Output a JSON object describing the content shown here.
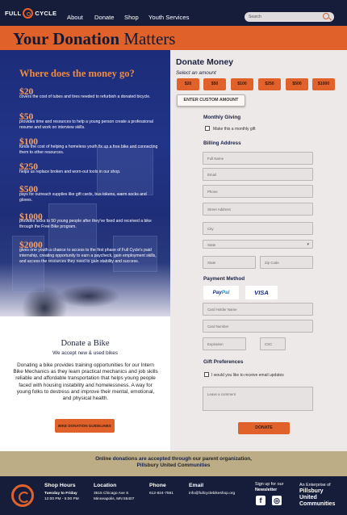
{
  "header": {
    "logo_text_left": "FULL",
    "logo_text_right": "CYCLE",
    "nav": [
      "About",
      "Donate",
      "Shop",
      "Youth Services"
    ],
    "search_placeholder": "Search"
  },
  "page_title": {
    "bold": "Your Donation",
    "normal": "Matters"
  },
  "money": {
    "heading": "Where does the money go?",
    "items": [
      {
        "amount": "$20",
        "text": "covers the cost of tubes and tires needed to refurbish a donated bicycle."
      },
      {
        "amount": "$50",
        "text": "provides time and resources to help a young person create a professional resume and work on interview skills."
      },
      {
        "amount": "$100",
        "text": "funds the cost of helping a homeless youth fix up a free bike and connecting them to other resources."
      },
      {
        "amount": "$250",
        "text": "helps us replace broken and worn-out tools in our shop."
      },
      {
        "amount": "$500",
        "text": "pays for outreach supplies like gift cards, bus tokens, warm socks and gloves."
      },
      {
        "amount": "$1000",
        "text": "provides locks to 50 young people after they've fixed and received a bike through the Free Bike program."
      },
      {
        "amount": "$2000",
        "text": "gives one youth a chance to access to the first phase of Full Cycle's paid internship, creating opportunity to earn a paycheck, gain employment skills, and access the resources they need to gain stability and success."
      }
    ]
  },
  "bike": {
    "title": "Donate a Bike",
    "subtitle": "We accept new & used bikes",
    "body": "Donating a bike provides training opportunities for our Intern Bike Mechanics as they learn practical mechanics and job skills reliable and affordable transportation that helps young people faced with housing instability and homelessness. A way for young folks to destress and improve their mental, emotional, and physical health.",
    "button": "BIKE DONATION GUIDELINES"
  },
  "form": {
    "title": "Donate Money",
    "subtitle": "Select an amount",
    "amounts": [
      "$20",
      "$50",
      "$100",
      "$250",
      "$500",
      "$1000"
    ],
    "custom_button": "ENTER CUSTOM AMOUNT",
    "monthly_heading": "Monthly Giving",
    "monthly_label": "Make this a monthly gift",
    "billing_heading": "Billing Address",
    "fields": {
      "full_name": "Full Name",
      "email": "Email",
      "phone": "Phone",
      "street": "Street Address",
      "city": "City",
      "state_select": "State",
      "state": "State",
      "zip": "Zip Code"
    },
    "payment_heading": "Payment Method",
    "paypal_a": "Pay",
    "paypal_b": "Pal",
    "visa": "VISA",
    "card_fields": {
      "holder": "Card Holder Name",
      "number": "Card Number",
      "expiration": "Expiration",
      "csc": "CSC"
    },
    "gift_heading": "Gift Preferences",
    "gift_label": "I would you like to receive email updates",
    "comment_placeholder": "Leave a comment",
    "donate_button": "DONATE"
  },
  "partner": {
    "line1": "Online donations are accepted through our parent organization,",
    "line2": "Pillsbury United Communities"
  },
  "footer": {
    "hours_heading": "Shop Hours",
    "hours_days": "Tuesday to Friday",
    "hours_time": "12:00 PM - 5:00 PM",
    "location_heading": "Location",
    "location_line1": "3515 Chicago Ave S",
    "location_line2": "Minneapolis, MN 55407",
    "phone_heading": "Phone",
    "phone": "612-824-7591",
    "email_heading": "Email",
    "email": "info@fullcyclebikeshop.org",
    "signup_line1": "Sign up for our",
    "signup_line2": "Newsletter",
    "enterprise_line1": "An Enterprise of",
    "enterprise_line2": "Pillsbury",
    "enterprise_line3": "United",
    "enterprise_line4": "Communities",
    "facebook_icon": "f",
    "instagram_icon": "◎"
  },
  "colors": {
    "navy": "#161d3a",
    "orange": "#e0622a",
    "tan": "#bcad86"
  }
}
